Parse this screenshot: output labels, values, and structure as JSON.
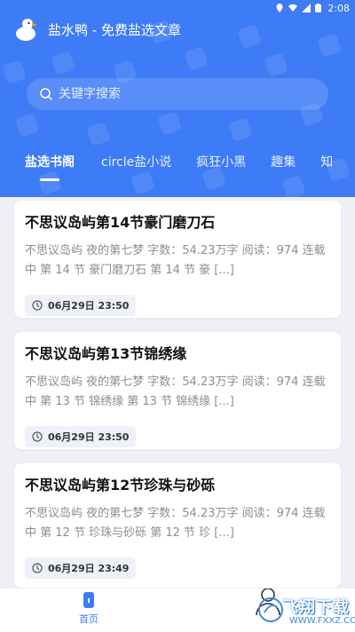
{
  "status_bar": {
    "time": "2:08"
  },
  "app": {
    "title": "盐水鸭 - 免费盐选文章"
  },
  "search": {
    "placeholder": "关键字搜索"
  },
  "tabs": [
    {
      "label": "盐选书阁",
      "active": true
    },
    {
      "label": "circle盐小说",
      "active": false
    },
    {
      "label": "疯狂小黑",
      "active": false
    },
    {
      "label": "趣集",
      "active": false
    },
    {
      "label": "知",
      "active": false
    }
  ],
  "articles": [
    {
      "title": "不思议岛屿第14节豪门磨刀石",
      "desc": "不思议岛屿 夜的第七梦 字数：54.23万字 阅读：974 连载中 第 14 节 豪门磨刀石 第 14 节 豪 [...]",
      "time": "06月29日 23:50"
    },
    {
      "title": "不思议岛屿第13节锦绣缘",
      "desc": "不思议岛屿 夜的第七梦 字数：54.23万字 阅读：974 连载中 第 13 节 锦绣缘 第 13 节 锦绣缘 [...]",
      "time": "06月29日 23:50"
    },
    {
      "title": "不思议岛屿第12节珍珠与砂砾",
      "desc": "不思议岛屿 夜的第七梦 字数：54.23万字 阅读：974 连载中 第 12 节 珍珠与砂砾 第 12 节 珍 [...]",
      "time": "06月29日 23:49"
    }
  ],
  "bottom_nav": {
    "home_label": "首页"
  },
  "watermark": {
    "main": "飞翔下载",
    "sub": "WWW.FXXZ.COM"
  },
  "colors": {
    "primary": "#3e7bf6",
    "page_bg": "#eef0f6",
    "text_secondary": "#8e8e93"
  }
}
